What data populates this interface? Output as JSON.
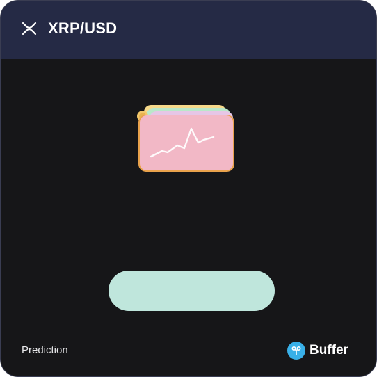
{
  "header": {
    "title": "XRP/USD",
    "icon": "xrp-icon",
    "background": "#252a45"
  },
  "main": {
    "background": "#161618",
    "illustration": "pink-chart-card-illustration",
    "pill_color": "#bfe6dc"
  },
  "footer": {
    "label": "Prediction",
    "brand_name": "Buffer",
    "brand_icon": "buffer-logo-icon",
    "brand_color": "#39b0e8"
  }
}
